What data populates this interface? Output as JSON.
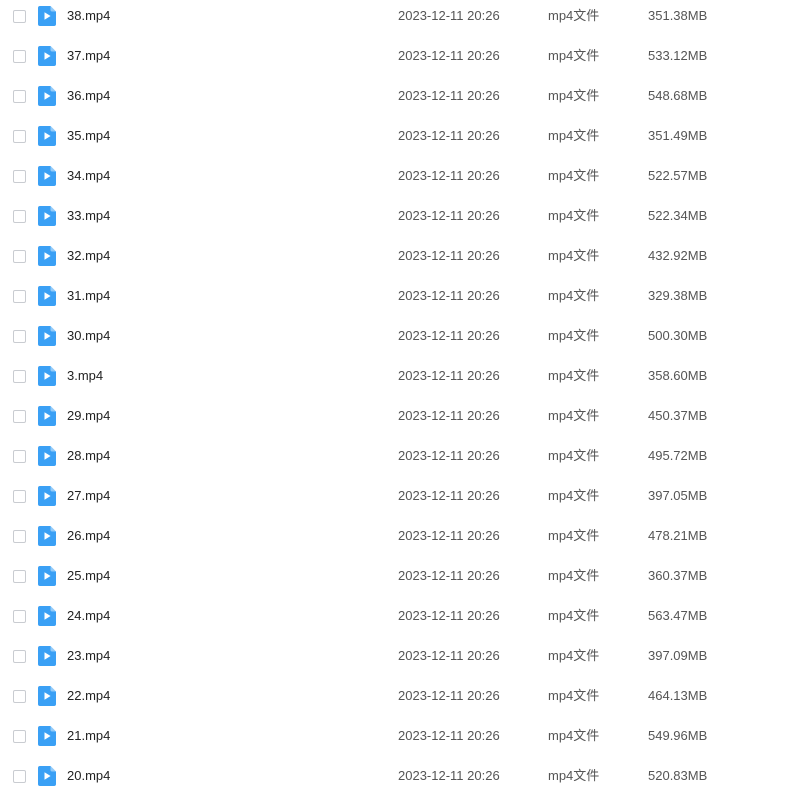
{
  "file_list": {
    "icon": "video-file-icon",
    "accent_color": "#3aa0f5",
    "rows": [
      {
        "name": "38.mp4",
        "date": "2023-12-11 20:26",
        "type": "mp4文件",
        "size": "351.38MB"
      },
      {
        "name": "37.mp4",
        "date": "2023-12-11 20:26",
        "type": "mp4文件",
        "size": "533.12MB"
      },
      {
        "name": "36.mp4",
        "date": "2023-12-11 20:26",
        "type": "mp4文件",
        "size": "548.68MB"
      },
      {
        "name": "35.mp4",
        "date": "2023-12-11 20:26",
        "type": "mp4文件",
        "size": "351.49MB"
      },
      {
        "name": "34.mp4",
        "date": "2023-12-11 20:26",
        "type": "mp4文件",
        "size": "522.57MB"
      },
      {
        "name": "33.mp4",
        "date": "2023-12-11 20:26",
        "type": "mp4文件",
        "size": "522.34MB"
      },
      {
        "name": "32.mp4",
        "date": "2023-12-11 20:26",
        "type": "mp4文件",
        "size": "432.92MB"
      },
      {
        "name": "31.mp4",
        "date": "2023-12-11 20:26",
        "type": "mp4文件",
        "size": "329.38MB"
      },
      {
        "name": "30.mp4",
        "date": "2023-12-11 20:26",
        "type": "mp4文件",
        "size": "500.30MB"
      },
      {
        "name": "3.mp4",
        "date": "2023-12-11 20:26",
        "type": "mp4文件",
        "size": "358.60MB"
      },
      {
        "name": "29.mp4",
        "date": "2023-12-11 20:26",
        "type": "mp4文件",
        "size": "450.37MB"
      },
      {
        "name": "28.mp4",
        "date": "2023-12-11 20:26",
        "type": "mp4文件",
        "size": "495.72MB"
      },
      {
        "name": "27.mp4",
        "date": "2023-12-11 20:26",
        "type": "mp4文件",
        "size": "397.05MB"
      },
      {
        "name": "26.mp4",
        "date": "2023-12-11 20:26",
        "type": "mp4文件",
        "size": "478.21MB"
      },
      {
        "name": "25.mp4",
        "date": "2023-12-11 20:26",
        "type": "mp4文件",
        "size": "360.37MB"
      },
      {
        "name": "24.mp4",
        "date": "2023-12-11 20:26",
        "type": "mp4文件",
        "size": "563.47MB"
      },
      {
        "name": "23.mp4",
        "date": "2023-12-11 20:26",
        "type": "mp4文件",
        "size": "397.09MB"
      },
      {
        "name": "22.mp4",
        "date": "2023-12-11 20:26",
        "type": "mp4文件",
        "size": "464.13MB"
      },
      {
        "name": "21.mp4",
        "date": "2023-12-11 20:26",
        "type": "mp4文件",
        "size": "549.96MB"
      },
      {
        "name": "20.mp4",
        "date": "2023-12-11 20:26",
        "type": "mp4文件",
        "size": "520.83MB"
      }
    ]
  }
}
